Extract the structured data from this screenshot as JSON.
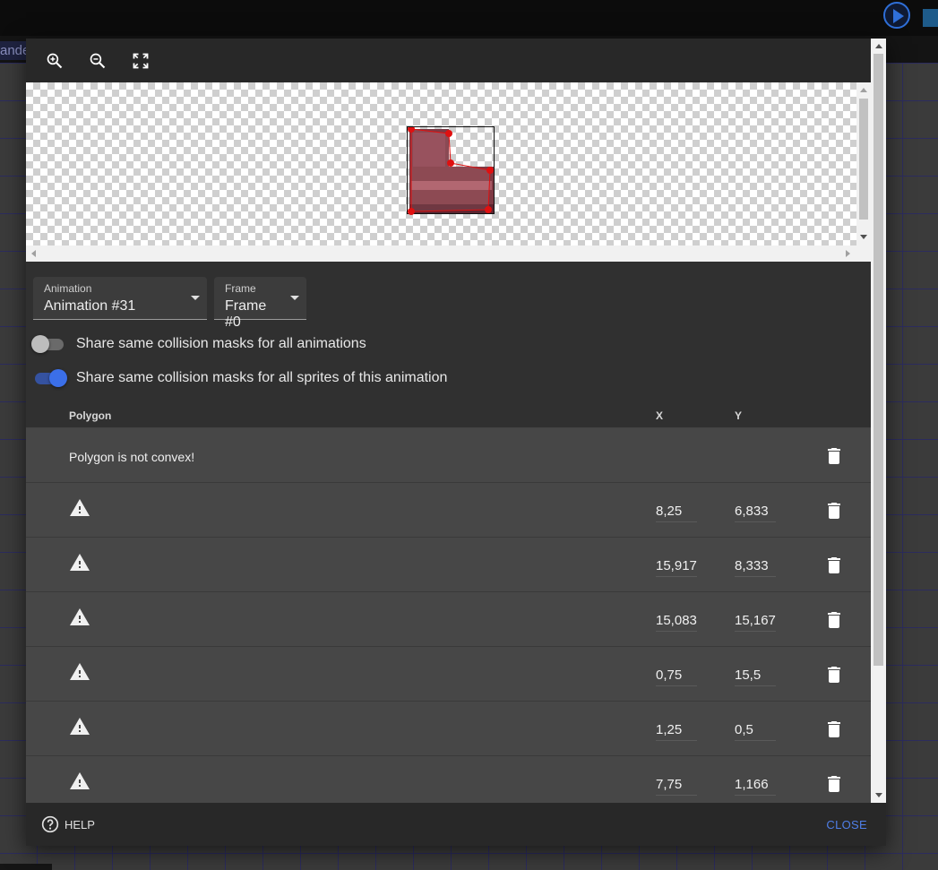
{
  "background": {
    "tab_fragment": "ande"
  },
  "dialog": {
    "toolbar": {
      "zoom_in_icon": "zoom-in-icon",
      "zoom_out_icon": "zoom-out-icon",
      "fit_icon": "fullscreen-icon"
    },
    "animation_select": {
      "label": "Animation",
      "value": "Animation #31"
    },
    "frame_select": {
      "label": "Frame",
      "value": "Frame #0"
    },
    "toggles": [
      {
        "label": "Share same collision masks for all animations",
        "checked": false
      },
      {
        "label": "Share same collision masks for all sprites of this animation",
        "checked": true
      }
    ],
    "table": {
      "headers": {
        "polygon": "Polygon",
        "x": "X",
        "y": "Y"
      },
      "polygon_title": "Polygon is not convex!",
      "vertices": [
        {
          "x": "8,25",
          "y": "6,833"
        },
        {
          "x": "15,917",
          "y": "8,333"
        },
        {
          "x": "15,083",
          "y": "15,167"
        },
        {
          "x": "0,75",
          "y": "15,5"
        },
        {
          "x": "1,25",
          "y": "0,5"
        },
        {
          "x": "7,75",
          "y": "1,166"
        }
      ]
    },
    "footer": {
      "help": "HELP",
      "close": "CLOSE"
    },
    "colors": {
      "accent": "#3b6fe8",
      "vertex": "#e01010",
      "sprite": "#7e3a44"
    }
  }
}
